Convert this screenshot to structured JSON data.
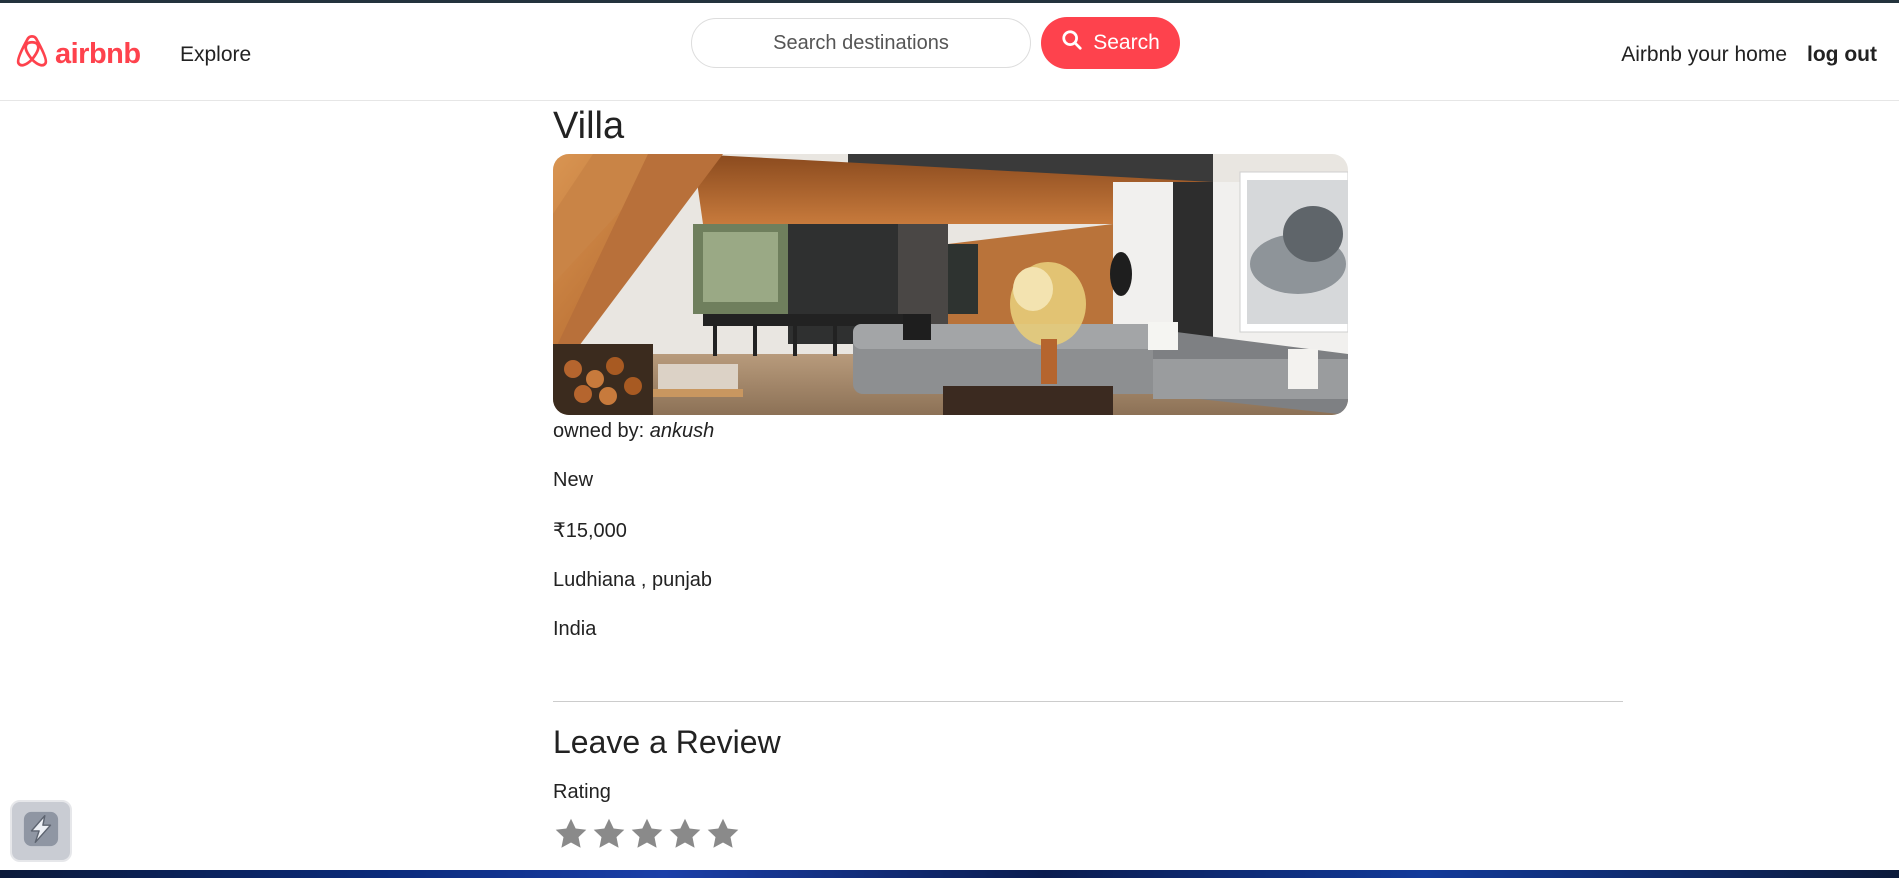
{
  "navbar": {
    "brand_name": "airbnb",
    "brand_icon": "airbnb-logo-icon",
    "explore_label": "Explore",
    "search_placeholder": "Search destinations",
    "search_button_label": "Search",
    "search_icon": "search-icon",
    "host_label": "Airbnb your home",
    "logout_label": "log out",
    "accent_color": "#fe424d"
  },
  "listing": {
    "title": "Villa",
    "image_alt": "Modern villa living room interior",
    "owner_prefix": "owned by: ",
    "owner_name": "ankush",
    "description": "New",
    "price": "₹15,000",
    "location": "Ludhiana , punjab",
    "country": "India"
  },
  "review": {
    "heading": "Leave a Review",
    "rating_label": "Rating",
    "stars": [
      "star-1",
      "star-2",
      "star-3",
      "star-4",
      "star-5"
    ],
    "star_icon": "star-icon"
  },
  "widget": {
    "icon": "app-widget-icon"
  }
}
